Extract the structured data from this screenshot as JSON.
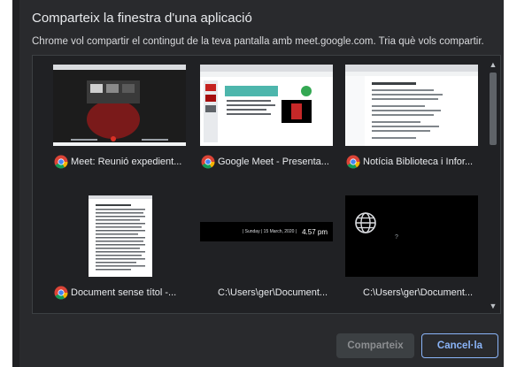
{
  "dialog": {
    "title": "Comparteix la finestra d'una aplicació",
    "subtitle": "Chrome vol compartir el contingut de la teva pantalla amb meet.google.com. Tria què vols compartir.",
    "windows": [
      {
        "label": "Meet: Reunió expedient...",
        "icon": "chrome-icon"
      },
      {
        "label": "Google Meet - Presenta...",
        "icon": "chrome-icon"
      },
      {
        "label": "Notícia Biblioteca i Infor...",
        "icon": "chrome-icon"
      },
      {
        "label": "Document sense títol -...",
        "icon": "chrome-icon"
      },
      {
        "label": "C:\\Users\\ger\\Document...",
        "icon": "",
        "thumb_text": "| Sunday | 15 March, 2020 |",
        "thumb_time": "4.57 pm"
      },
      {
        "label": "C:\\Users\\ger\\Document...",
        "icon": "",
        "thumb_text": "?"
      }
    ],
    "buttons": {
      "share": "Comparteix",
      "cancel": "Cancel·la"
    }
  },
  "colors": {
    "background": "#292a2d",
    "accent": "#8ab4f8",
    "list_bg": "#202124"
  }
}
